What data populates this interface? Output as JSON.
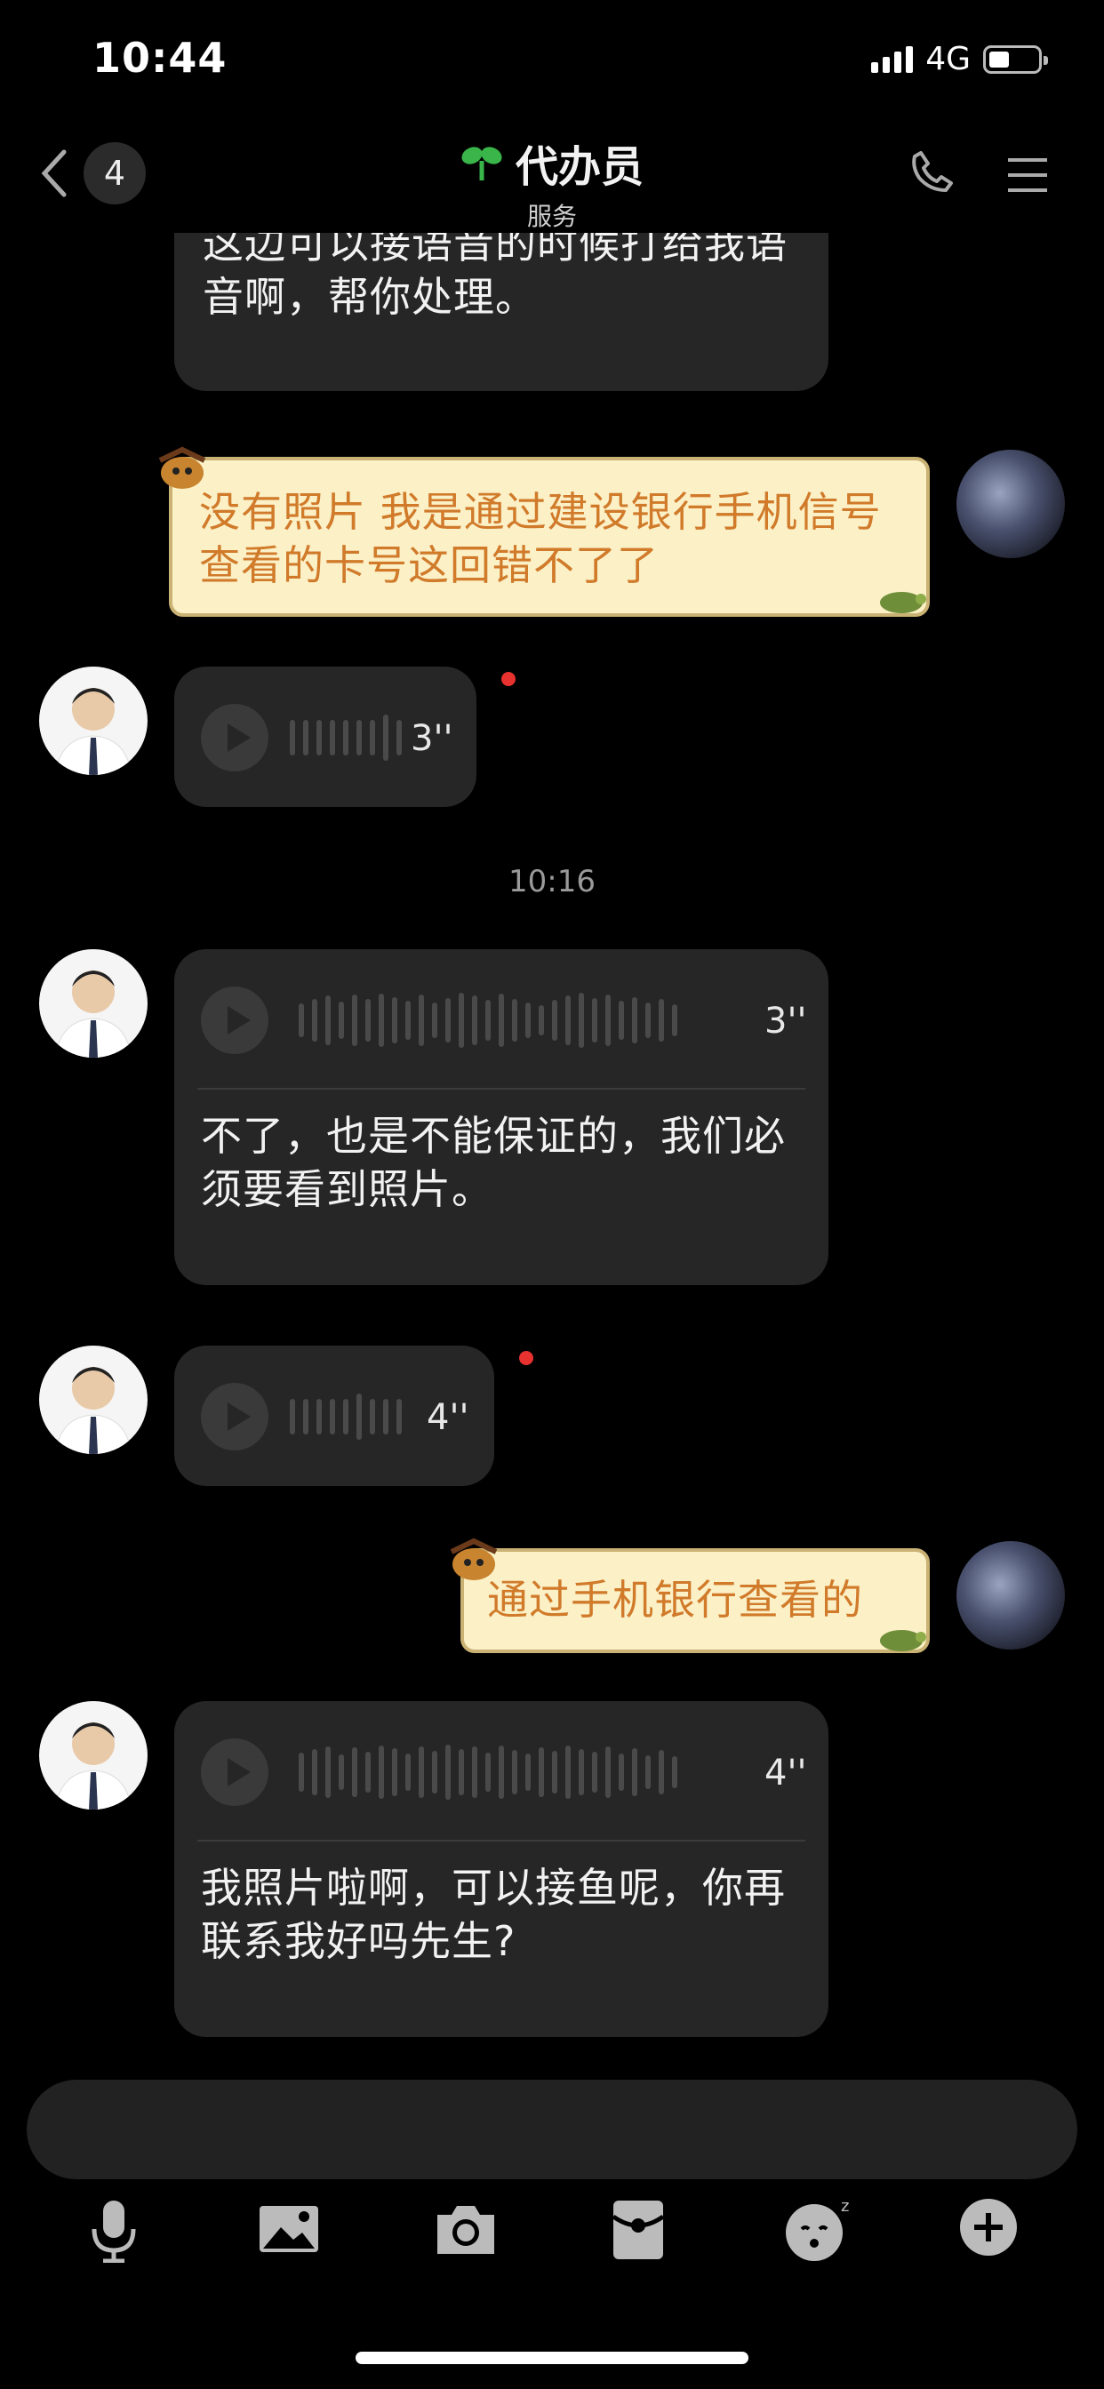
{
  "status_bar": {
    "time": "10:44",
    "network": "4G"
  },
  "nav": {
    "back_count": "4",
    "title": "代办员",
    "subtitle": "服务"
  },
  "messages": [
    {
      "type": "received_text",
      "text": "这边可以接语音的时候打给我语音啊，帮你处理。"
    },
    {
      "type": "sent_text",
      "text": "没有照片 我是通过建设银行手机信号查看的卡号这回错不了了"
    },
    {
      "type": "received_voice",
      "duration": "3''",
      "unread": true
    },
    {
      "type": "timestamp",
      "text": "10:16"
    },
    {
      "type": "received_voice_transcript",
      "duration": "3''",
      "text": "不了，也是不能保证的，我们必须要看到照片。"
    },
    {
      "type": "received_voice",
      "duration": "4''",
      "unread": true
    },
    {
      "type": "sent_text",
      "text": "通过手机银行查看的"
    },
    {
      "type": "received_voice_transcript",
      "duration": "4''",
      "text": "我照片啦啊，可以接鱼呢，你再联系我好吗先生?"
    }
  ],
  "toolbar": {
    "items": [
      "microphone-icon",
      "image-icon",
      "camera-icon",
      "red-packet-icon",
      "emoji-icon",
      "plus-icon"
    ]
  },
  "colors": {
    "background": "#000000",
    "received_bubble": "#262626",
    "sent_bubble": "#fbf0c6",
    "sent_text": "#d07a2a",
    "unread_dot": "#e8322f"
  }
}
